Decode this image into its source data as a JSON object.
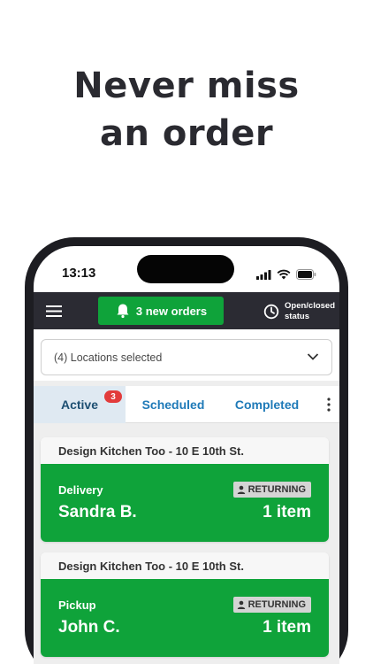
{
  "headline": {
    "line1": "Never miss",
    "line2": "an order"
  },
  "status_bar": {
    "time": "13:13"
  },
  "app_bar": {
    "menu_icon": "hamburger-menu-icon",
    "new_orders_label": "3 new orders",
    "new_orders_icon": "bell-icon",
    "open_status_line1": "Open/closed",
    "open_status_line2": "status",
    "open_status_icon": "clock-icon"
  },
  "location_filter": {
    "label": "(4) Locations selected"
  },
  "tabs": [
    {
      "label": "Active",
      "badge": "3",
      "active": true
    },
    {
      "label": "Scheduled"
    },
    {
      "label": "Completed"
    }
  ],
  "orders": [
    {
      "location": "Design Kitchen Too - 10 E 10th St.",
      "type": "Delivery",
      "customer": "Sandra B.",
      "tag": "RETURNING",
      "items": "1 item"
    },
    {
      "location": "Design Kitchen Too - 10 E 10th St.",
      "type": "Pickup",
      "customer": "John C.",
      "tag": "RETURNING",
      "items": "1 item"
    }
  ],
  "colors": {
    "headline": "#2a2a30",
    "app_bar": "#2b2b33",
    "accent_green": "#0fa33a",
    "tab_link": "#1f7ab8",
    "badge_red": "#e23b3b"
  }
}
